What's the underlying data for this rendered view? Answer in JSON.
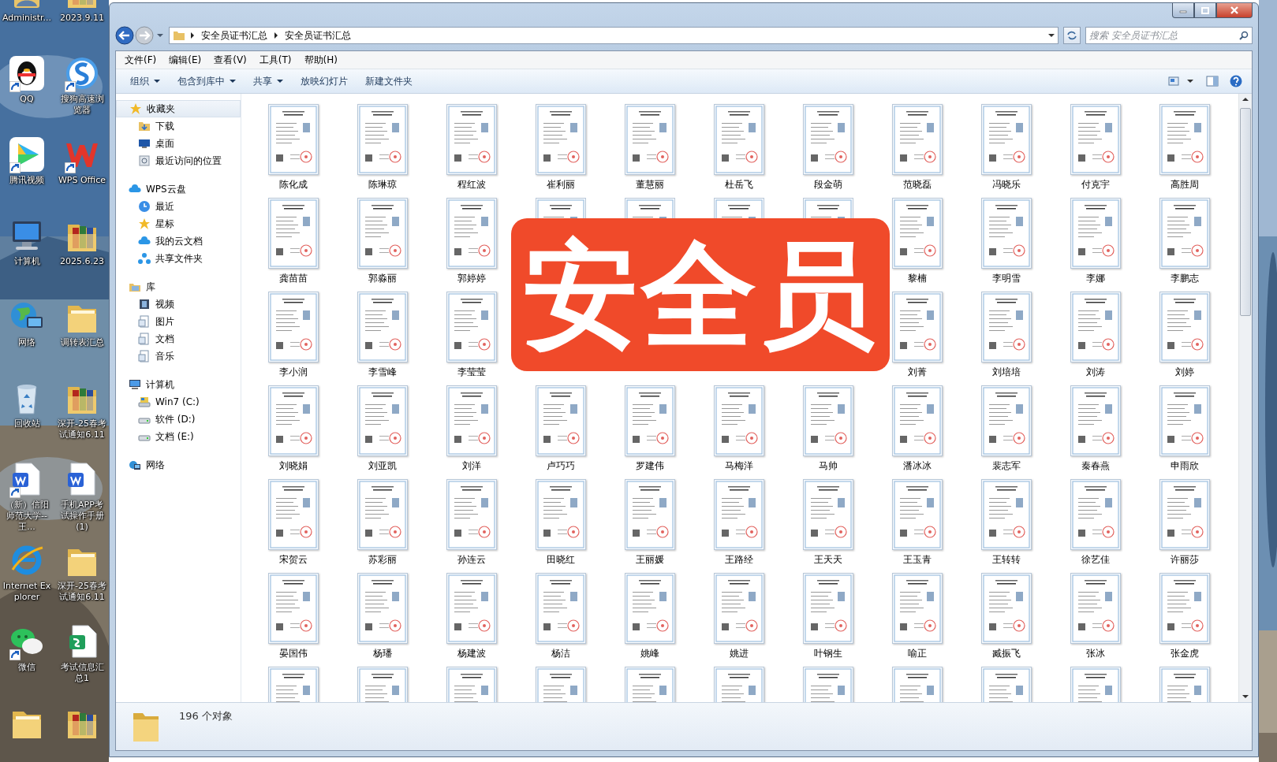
{
  "desktop": {
    "icons": [
      {
        "label": "Administr...",
        "kind": "user",
        "shortcut": false
      },
      {
        "label": "QQ",
        "kind": "penguin",
        "shortcut": true
      },
      {
        "label": "腾讯视频",
        "kind": "video",
        "shortcut": true
      },
      {
        "label": "计算机",
        "kind": "computer",
        "shortcut": false
      },
      {
        "label": "网络",
        "kind": "globe",
        "shortcut": false
      },
      {
        "label": "回收站",
        "kind": "recycle",
        "shortcut": false
      },
      {
        "label": "（新）信阳师范大学--王...",
        "kind": "word",
        "shortcut": true
      },
      {
        "label": "Internet Explorer",
        "kind": "ie",
        "shortcut": false
      },
      {
        "label": "微信",
        "kind": "chat",
        "shortcut": true
      },
      {
        "kind": "folder",
        "shortcut": false
      },
      {
        "label": "2023.9.11",
        "kind": "archive",
        "shortcut": false
      },
      {
        "label": "搜狗高速浏览器",
        "kind": "browser",
        "shortcut": true
      },
      {
        "label": "WPS Office",
        "kind": "wps",
        "shortcut": true
      },
      {
        "label": "2025.6.23",
        "kind": "archive",
        "shortcut": false
      },
      {
        "label": "调转表汇总",
        "kind": "folder",
        "shortcut": false
      },
      {
        "label": "深开-25春考试通知6.11",
        "kind": "archive",
        "shortcut": false
      },
      {
        "label": "手机APP考试操作手册(1)",
        "kind": "word",
        "shortcut": false
      },
      {
        "label": "深开-25春考试通知6.11",
        "kind": "folder",
        "shortcut": false
      },
      {
        "label": "考试信息汇总1",
        "kind": "sheet",
        "shortcut": false
      },
      {
        "kind": "archive",
        "shortcut": false
      }
    ]
  },
  "address_bar": {
    "path": [
      "安全员证书汇总",
      "安全员证书汇总"
    ]
  },
  "search": {
    "placeholder": "搜索 安全员证书汇总"
  },
  "menu": [
    "文件(F)",
    "编辑(E)",
    "查看(V)",
    "工具(T)",
    "帮助(H)"
  ],
  "toolbar": [
    {
      "label": "组织",
      "dropdown": true
    },
    {
      "label": "包含到库中",
      "dropdown": true
    },
    {
      "label": "共享",
      "dropdown": true
    },
    {
      "label": "放映幻灯片",
      "dropdown": false
    },
    {
      "label": "新建文件夹",
      "dropdown": false
    }
  ],
  "sidebar": {
    "groups": [
      {
        "label": "收藏夹",
        "kind": "star",
        "selected": true,
        "children": [
          {
            "label": "下载",
            "kind": "download",
            "selected": false
          },
          {
            "label": "桌面",
            "kind": "desktop",
            "selected": false
          },
          {
            "label": "最近访问的位置",
            "kind": "recent",
            "selected": false
          }
        ]
      },
      {
        "label": "WPS云盘",
        "kind": "cloud",
        "selected": false,
        "children": [
          {
            "label": "最近",
            "kind": "clock",
            "selected": false
          },
          {
            "label": "星标",
            "kind": "star",
            "selected": false
          },
          {
            "label": "我的云文档",
            "kind": "cloud",
            "selected": false
          },
          {
            "label": "共享文件夹",
            "kind": "share",
            "selected": false
          }
        ]
      },
      {
        "label": "库",
        "kind": "library",
        "selected": false,
        "children": [
          {
            "label": "视频",
            "kind": "film",
            "selected": false
          },
          {
            "label": "图片",
            "kind": "doc",
            "selected": false
          },
          {
            "label": "文档",
            "kind": "doc",
            "selected": false
          },
          {
            "label": "音乐",
            "kind": "doc",
            "selected": false
          }
        ]
      },
      {
        "label": "计算机",
        "kind": "computer",
        "selected": false,
        "children": [
          {
            "label": "Win7 (C:)",
            "kind": "system-drive",
            "selected": false
          },
          {
            "label": "软件 (D:)",
            "kind": "drive",
            "selected": false
          },
          {
            "label": "文档 (E:)",
            "kind": "drive",
            "selected": false
          }
        ]
      },
      {
        "label": "网络",
        "kind": "network",
        "selected": false
      }
    ]
  },
  "files": [
    {
      "kind": "file",
      "name": "陈化成"
    },
    {
      "kind": "file",
      "name": "陈琳琼"
    },
    {
      "kind": "file",
      "name": "程红波"
    },
    {
      "kind": "file",
      "name": "崔利丽"
    },
    {
      "kind": "file",
      "name": "董慧丽"
    },
    {
      "kind": "file",
      "name": "杜岳飞"
    },
    {
      "kind": "file",
      "name": "段金萌"
    },
    {
      "kind": "file",
      "name": "范晓磊"
    },
    {
      "kind": "file",
      "name": "冯晓乐"
    },
    {
      "kind": "file",
      "name": "付克宇"
    },
    {
      "kind": "file",
      "name": "高胜周"
    },
    {
      "kind": "file",
      "name": "龚苗苗"
    },
    {
      "kind": "file",
      "name": "郭淼丽"
    },
    {
      "kind": "file",
      "name": "郭婷婷"
    },
    {
      "kind": "covered"
    },
    {
      "kind": "covered"
    },
    {
      "kind": "covered"
    },
    {
      "kind": "covered"
    },
    {
      "kind": "file",
      "name": "黎楠"
    },
    {
      "kind": "file",
      "name": "李明雪"
    },
    {
      "kind": "file",
      "name": "李娜"
    },
    {
      "kind": "file",
      "name": "李鹏志"
    },
    {
      "kind": "file",
      "name": "李小润"
    },
    {
      "kind": "file",
      "name": "李雪峰"
    },
    {
      "kind": "file",
      "name": "李莹莹"
    },
    {
      "kind": "hidden"
    },
    {
      "kind": "hidden"
    },
    {
      "kind": "hidden"
    },
    {
      "kind": "hidden"
    },
    {
      "kind": "file",
      "name": "刘菁"
    },
    {
      "kind": "file",
      "name": "刘培培"
    },
    {
      "kind": "file",
      "name": "刘涛"
    },
    {
      "kind": "file",
      "name": "刘婷"
    },
    {
      "kind": "file",
      "name": "刘晓娟"
    },
    {
      "kind": "file",
      "name": "刘亚凯"
    },
    {
      "kind": "file",
      "name": "刘洋"
    },
    {
      "kind": "file",
      "name": "卢巧巧"
    },
    {
      "kind": "file",
      "name": "罗建伟"
    },
    {
      "kind": "file",
      "name": "马梅洋"
    },
    {
      "kind": "file",
      "name": "马帅"
    },
    {
      "kind": "file",
      "name": "潘冰冰"
    },
    {
      "kind": "file",
      "name": "裴志军"
    },
    {
      "kind": "file",
      "name": "秦春燕"
    },
    {
      "kind": "file",
      "name": "申雨欣"
    },
    {
      "kind": "file",
      "name": "宋贺云"
    },
    {
      "kind": "file",
      "name": "苏彩丽"
    },
    {
      "kind": "file",
      "name": "孙连云"
    },
    {
      "kind": "file",
      "name": "田晓红"
    },
    {
      "kind": "file",
      "name": "王丽媛"
    },
    {
      "kind": "file",
      "name": "王路经"
    },
    {
      "kind": "file",
      "name": "王天天"
    },
    {
      "kind": "file",
      "name": "王玉青"
    },
    {
      "kind": "file",
      "name": "王转转"
    },
    {
      "kind": "file",
      "name": "徐艺佳"
    },
    {
      "kind": "file",
      "name": "许丽莎"
    },
    {
      "kind": "file",
      "name": "晏国伟"
    },
    {
      "kind": "file",
      "name": "杨璠"
    },
    {
      "kind": "file",
      "name": "杨建波"
    },
    {
      "kind": "file",
      "name": "杨洁"
    },
    {
      "kind": "file",
      "name": "姚峰"
    },
    {
      "kind": "file",
      "name": "姚进"
    },
    {
      "kind": "file",
      "name": "叶钢生"
    },
    {
      "kind": "file",
      "name": "喻正"
    },
    {
      "kind": "file",
      "name": "臧振飞"
    },
    {
      "kind": "file",
      "name": "张冰"
    },
    {
      "kind": "file",
      "name": "张金虎"
    },
    {
      "kind": "unlabeled"
    },
    {
      "kind": "unlabeled"
    },
    {
      "kind": "unlabeled"
    },
    {
      "kind": "unlabeled"
    },
    {
      "kind": "unlabeled"
    },
    {
      "kind": "unlabeled"
    },
    {
      "kind": "unlabeled"
    },
    {
      "kind": "unlabeled"
    },
    {
      "kind": "unlabeled"
    },
    {
      "kind": "unlabeled"
    },
    {
      "kind": "unlabeled"
    }
  ],
  "overlay": {
    "text": "安全员"
  },
  "status_bar": {
    "count": "196 个对象"
  }
}
